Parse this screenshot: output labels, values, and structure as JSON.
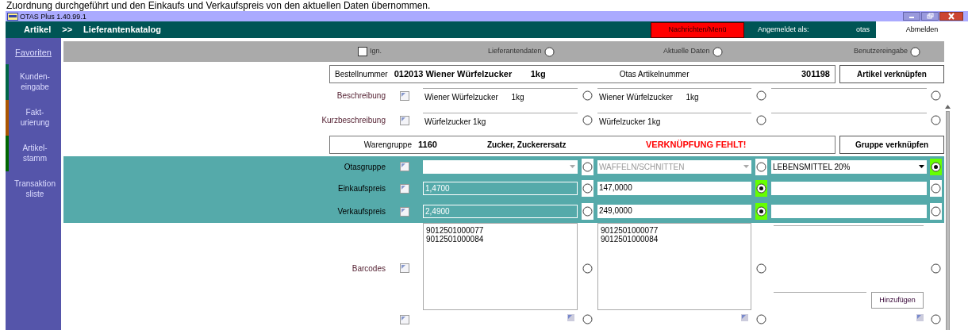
{
  "caption": "Zuordnung durchgeführt und den Einkaufs und Verkaufspreis von den aktuellen Daten übernommen.",
  "window": {
    "title": "OTAS Plus 1.40.99.1"
  },
  "header": {
    "breadcrumb": [
      "Artikel",
      ">>",
      "Lieferantenkatalog"
    ],
    "messages_button": "Nachrichten/Menü",
    "logged_in_label": "Angemeldet als:",
    "user": "otas",
    "logout_button": "Abmelden"
  },
  "sidebar": {
    "favorites": "Favoriten",
    "items": [
      {
        "label": "Kunden-\neingabe",
        "color": "#006644"
      },
      {
        "label": "Fakt-\nurierung",
        "color": "#aa5500"
      },
      {
        "label": "Artikel-\nstamm",
        "color": "#006600"
      },
      {
        "label": "Transaktion\nsliste",
        "color": "#5555aa"
      }
    ]
  },
  "source_bar": {
    "ignore": {
      "label": "Ign.",
      "checked": false
    },
    "options": [
      {
        "label": "Lieferantendaten",
        "selected": false
      },
      {
        "label": "Aktuelle Daten",
        "selected": false
      },
      {
        "label": "Benutzereingabe",
        "selected": false
      }
    ]
  },
  "article": {
    "order_label": "Bestellnummer",
    "order_number": "012013 Wiener Würfelzucker",
    "unit": "1kg",
    "otas_label": "Otas Artikelnummer",
    "otas_number": "301198",
    "link_button": "Artikel verknüpfen"
  },
  "rows_top": [
    {
      "kind": "text",
      "label": "Beschreibung",
      "checked": false,
      "highlighted": false,
      "cells": [
        {
          "value": "Wiener Würfelzucker      1kg",
          "selected": false
        },
        {
          "value": "Wiener Würfelzucker      1kg",
          "selected": false
        },
        {
          "selected": false
        }
      ]
    },
    {
      "kind": "text",
      "label": "Kurzbeschreibung",
      "checked": false,
      "highlighted": false,
      "cells": [
        {
          "value": "Würfelzucker 1kg",
          "selected": false
        },
        {
          "value": "Würfelzucker 1kg",
          "selected": false
        },
        {
          "selected": false
        }
      ]
    }
  ],
  "product_group": {
    "label": "Warengruppe",
    "number": "1160",
    "name": "Zucker, Zuckerersatz",
    "warning": "VERKNÜPFUNG FEHLT!",
    "link_button": "Gruppe verknüpfen"
  },
  "rows_bottom": [
    {
      "kind": "combo",
      "label": "Otasgruppe",
      "checked": false,
      "highlighted": true,
      "cells": [
        {
          "disabled": true,
          "selected": false
        },
        {
          "value": "WAFFELN/SCHNITTEN",
          "disabled": true,
          "selected": false
        },
        {
          "value": "LEBENSMITTEL 20%",
          "disabled": false,
          "selected": true
        }
      ]
    },
    {
      "kind": "price",
      "label": "Einkaufspreis",
      "checked": false,
      "highlighted": true,
      "cells": [
        {
          "value": "1,4700",
          "disabled": true,
          "selected": false
        },
        {
          "value": "147,0000",
          "disabled": false,
          "selected": true
        },
        {
          "disabled": false,
          "selected": false
        }
      ]
    },
    {
      "kind": "price",
      "label": "Verkaufspreis",
      "checked": false,
      "highlighted": true,
      "cells": [
        {
          "value": "2,4900",
          "disabled": true,
          "selected": false
        },
        {
          "value": "249,0000",
          "disabled": false,
          "selected": true
        },
        {
          "disabled": false,
          "selected": false
        }
      ]
    },
    {
      "kind": "list",
      "label": "Barcodes",
      "checked": false,
      "highlighted": false,
      "cells": [
        {
          "kind": "list",
          "lines": [
            "9012501000077",
            "9012501000084"
          ],
          "selected": false
        },
        {
          "kind": "list",
          "lines": [
            "9012501000077",
            "9012501000084"
          ],
          "selected": false
        },
        {
          "kind": "entry",
          "button": "Hinzufügen",
          "selected": false
        }
      ]
    },
    {
      "kind": "cut",
      "checked": false,
      "highlighted": false,
      "cells": [
        {
          "selected": false
        },
        {
          "selected": false
        },
        {
          "selected": false
        }
      ]
    }
  ]
}
